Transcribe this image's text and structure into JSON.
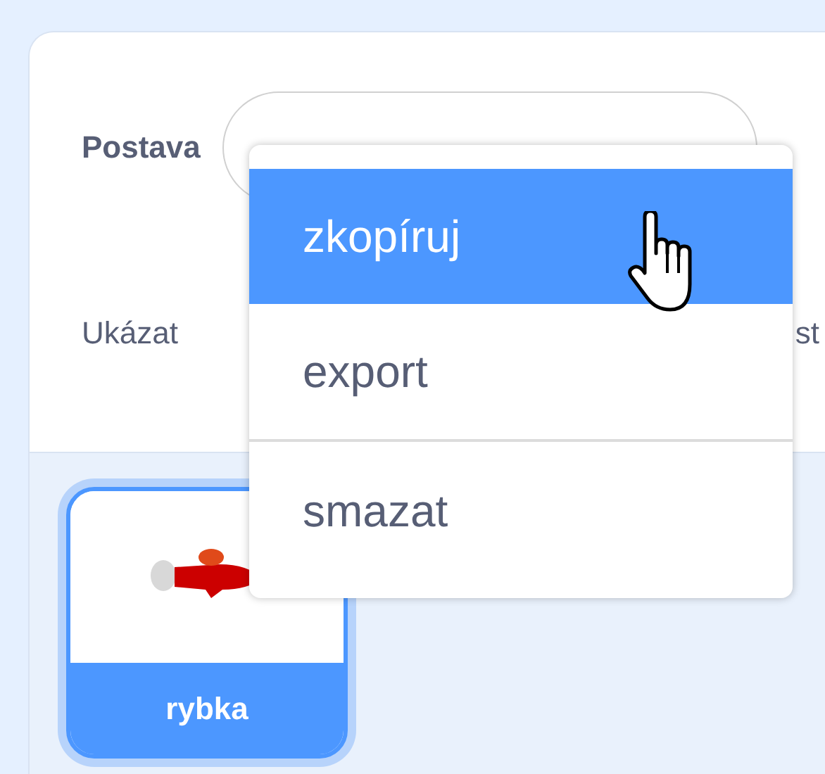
{
  "sprite_info": {
    "sprite_label": "Postava",
    "show_label": "Ukázat",
    "size_label_fragment": "st"
  },
  "context_menu": {
    "items": [
      {
        "label": "zkopíruj",
        "selected": true,
        "divider_above": false
      },
      {
        "label": "export",
        "selected": false,
        "divider_above": false
      },
      {
        "label": "smazat",
        "selected": false,
        "divider_above": true
      }
    ]
  },
  "sprites": [
    {
      "name": "rybka",
      "selected": true
    }
  ]
}
